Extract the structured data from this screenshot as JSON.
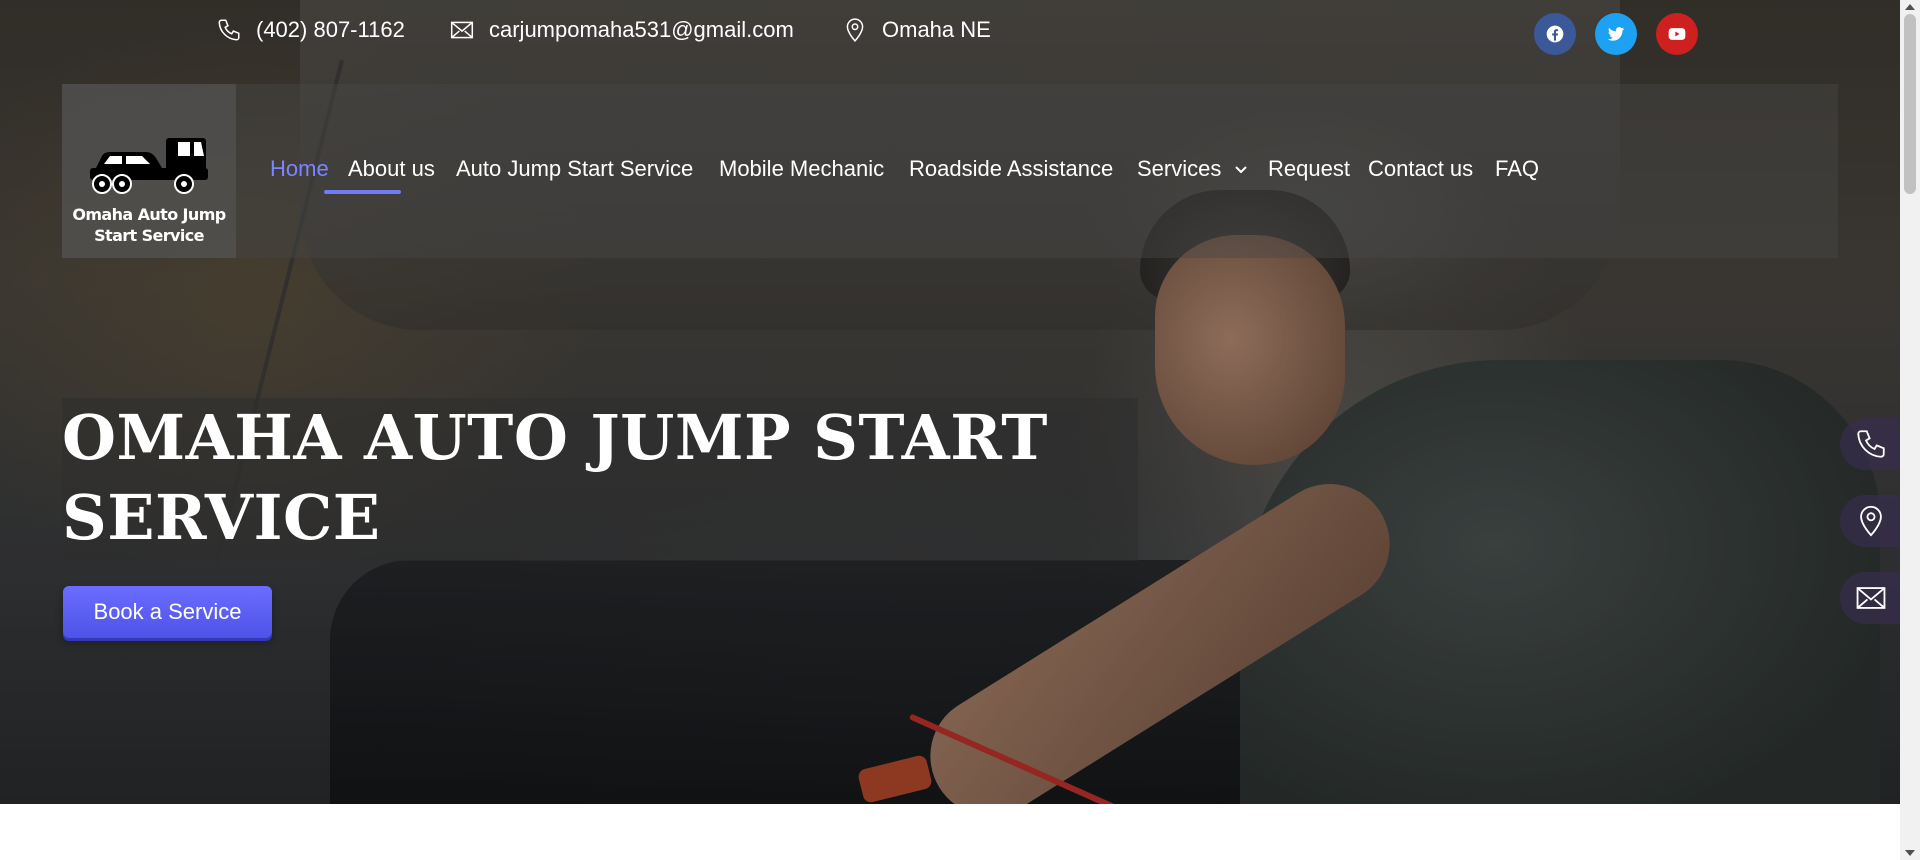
{
  "topbar": {
    "phone": "(402) 807-1162",
    "email": "carjumpomaha531@gmail.com",
    "location": "Omaha NE",
    "phone_icon": "phone-icon",
    "email_icon": "envelope-icon",
    "location_icon": "map-pin-icon"
  },
  "social": [
    {
      "name": "facebook-icon",
      "color": "#3b5998"
    },
    {
      "name": "twitter-icon",
      "color": "#1da1f2"
    },
    {
      "name": "youtube-icon",
      "color": "#cd201f"
    }
  ],
  "logo": {
    "text": "Omaha Auto Jump Start Service",
    "icon": "tow-truck-icon"
  },
  "nav": {
    "items": [
      {
        "label": "Home",
        "active": true
      },
      {
        "label": "About us"
      },
      {
        "label": "Auto Jump Start Service"
      },
      {
        "label": "Mobile Mechanic"
      },
      {
        "label": "Roadside Assistance"
      },
      {
        "label": "Services",
        "has_dropdown": true
      },
      {
        "label": "Request"
      },
      {
        "label": "Contact us"
      },
      {
        "label": "FAQ"
      }
    ],
    "active_color": "#7a86ff"
  },
  "hero": {
    "title": "OMAHA AUTO JUMP START SERVICE",
    "cta_label": "Book a Service",
    "cta_color": "#5b5df2"
  },
  "floating_actions": [
    {
      "name": "phone-icon"
    },
    {
      "name": "map-pin-icon"
    },
    {
      "name": "envelope-icon"
    }
  ]
}
